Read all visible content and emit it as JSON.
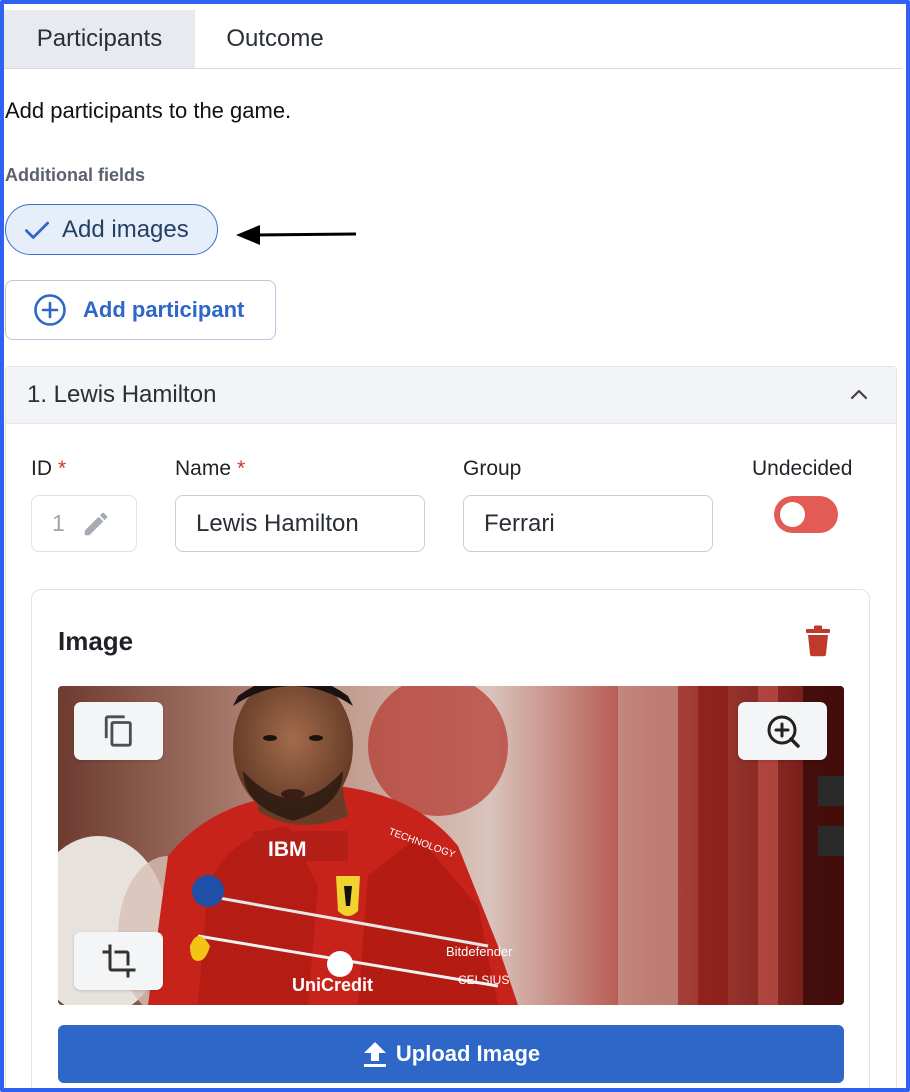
{
  "tabs": [
    {
      "label": "Participants",
      "active": true
    },
    {
      "label": "Outcome",
      "active": false
    }
  ],
  "intro_text": "Add participants to the game.",
  "additional_fields": {
    "label": "Additional fields",
    "chip_label": "Add images",
    "chip_checked": true
  },
  "add_participant_label": "Add participant",
  "participant": {
    "header": "1. Lewis Hamilton",
    "id_label": "ID",
    "id_value": "1",
    "name_label": "Name",
    "name_value": "Lewis Hamilton",
    "group_label": "Group",
    "group_value": "Ferrari",
    "undecided_label": "Undecided",
    "undecided_on": false,
    "required_marker": "*"
  },
  "image_section": {
    "title": "Image",
    "upload_label": "Upload Image",
    "photo_texts": [
      "IBM",
      "TECHNOLOGY",
      "Bitdefender",
      "UniCredit",
      "CELSIUS"
    ]
  },
  "colors": {
    "primary": "#2e67c8",
    "toggle_off": "#e25b55",
    "danger": "#c0392b",
    "frame": "#2f62f0"
  },
  "icons": [
    "check-icon",
    "arrow-left-icon",
    "plus-circle-icon",
    "chevron-up-icon",
    "pencil-icon",
    "trash-icon",
    "copy-icon",
    "zoom-in-icon",
    "crop-icon",
    "upload-icon"
  ]
}
